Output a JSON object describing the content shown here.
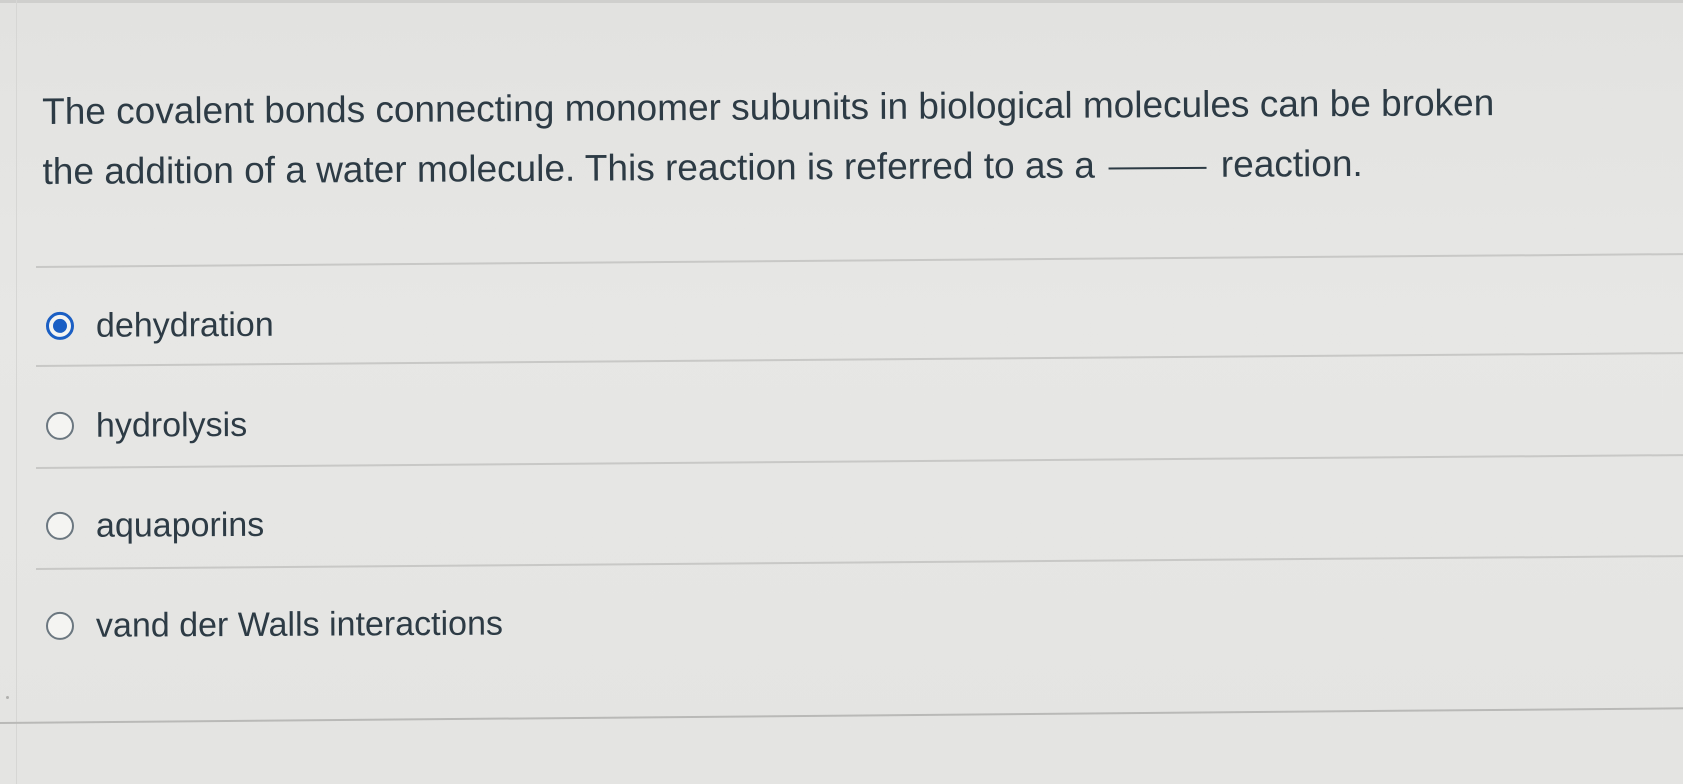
{
  "question": {
    "line1": "The covalent bonds connecting monomer subunits in biological molecules can be broken",
    "line2_before": "the addition of a water molecule. This reaction is referred to as a",
    "line2_after": "reaction."
  },
  "answers": [
    {
      "label": "dehydration",
      "selected": true
    },
    {
      "label": "hydrolysis",
      "selected": false
    },
    {
      "label": "aquaporins",
      "selected": false
    },
    {
      "label": "vand der Walls interactions",
      "selected": false
    }
  ],
  "colors": {
    "accent": "#1b5fc4",
    "text": "#2d3b45",
    "background": "#e5e5e3"
  }
}
